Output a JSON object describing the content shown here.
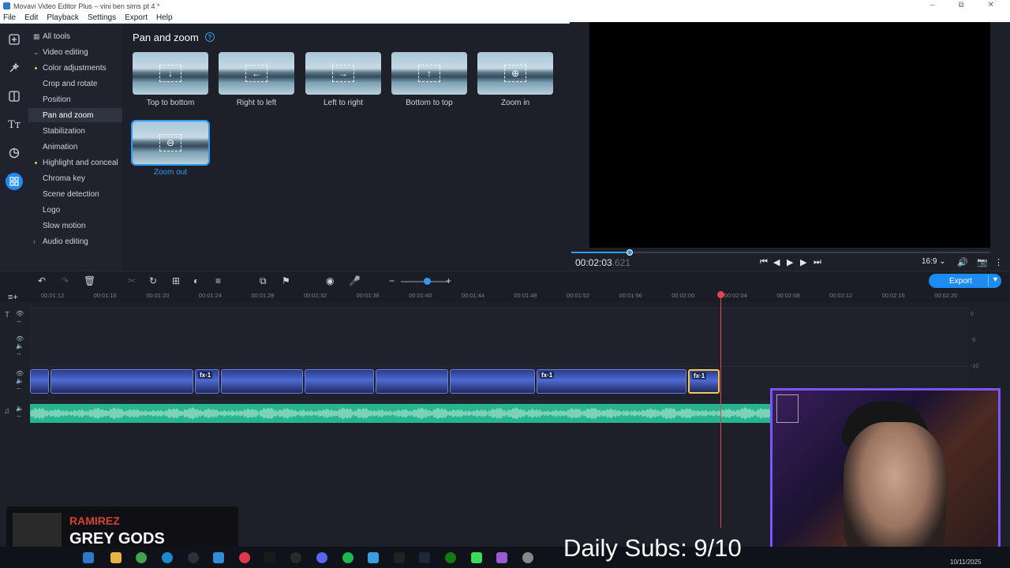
{
  "window": {
    "title": "Movavi Video Editor Plus – vini ben sims pt 4 *"
  },
  "menu": [
    "File",
    "Edit",
    "Playback",
    "Settings",
    "Export",
    "Help"
  ],
  "tools": [
    {
      "label": "All tools"
    },
    {
      "label": "Video editing"
    },
    {
      "label": "Color adjustments"
    },
    {
      "label": "Crop and rotate"
    },
    {
      "label": "Position"
    },
    {
      "label": "Pan and zoom"
    },
    {
      "label": "Stabilization"
    },
    {
      "label": "Animation"
    },
    {
      "label": "Highlight and conceal"
    },
    {
      "label": "Chroma key"
    },
    {
      "label": "Scene detection"
    },
    {
      "label": "Logo"
    },
    {
      "label": "Slow motion"
    },
    {
      "label": "Audio editing"
    }
  ],
  "panel": {
    "title": "Pan and zoom",
    "effects": [
      {
        "label": "Top to bottom",
        "icon": "arrow-down-icon"
      },
      {
        "label": "Right to left",
        "icon": "arrow-left-icon"
      },
      {
        "label": "Left to right",
        "icon": "arrow-right-icon"
      },
      {
        "label": "Bottom to top",
        "icon": "arrow-up-icon"
      },
      {
        "label": "Zoom in",
        "icon": "zoom-in-icon"
      },
      {
        "label": "Zoom out",
        "icon": "zoom-out-icon"
      }
    ]
  },
  "player": {
    "timecode": "00:02:03",
    "timecode_ms": ".621",
    "aspect": "16:9",
    "progress": 0.14
  },
  "timeline": {
    "export_label": "Export",
    "ruler": [
      "00:01:12",
      "00:01:16",
      "00:01:20",
      "00:01:24",
      "00:01:28",
      "00:01:32",
      "00:01:36",
      "00:01:40",
      "00:01:44",
      "00:01:48",
      "00:01:52",
      "00:01:56",
      "00:02:00",
      "00:02:04",
      "00:02:08",
      "00:02:12",
      "00:02:16",
      "00:02:20"
    ],
    "vu_labels": [
      "0",
      "-5",
      "-10"
    ],
    "fx_label": "fx·1"
  },
  "overlay": {
    "subs_text": "Daily Subs: 9/10",
    "alert_name": "RAMIREZ",
    "alert_message": "GREY GODS",
    "clock_date": "10/11/2025"
  },
  "colors": {
    "accent": "#1d8bef",
    "audio": "#26b58e",
    "playhead": "#e04550",
    "selected_clip": "#f2c94c"
  }
}
